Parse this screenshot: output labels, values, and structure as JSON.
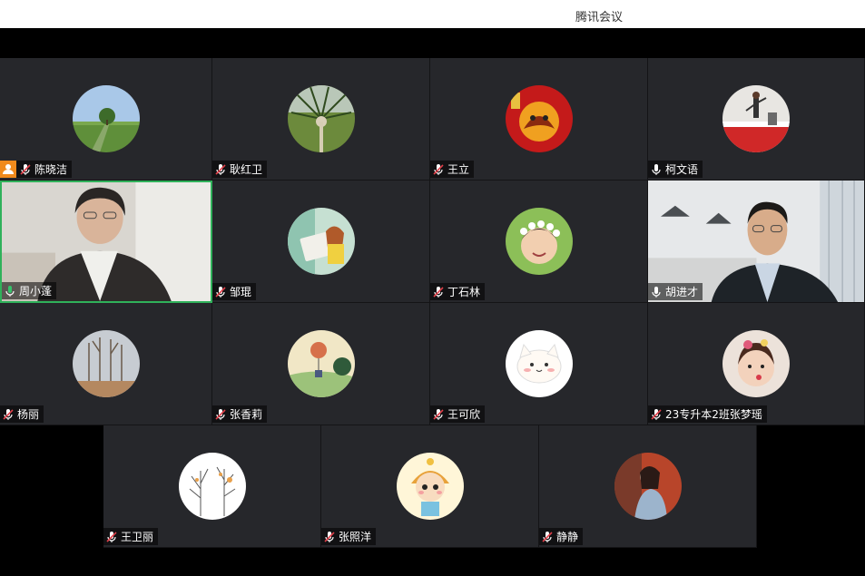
{
  "window": {
    "title": "腾讯会议"
  },
  "participants": [
    {
      "name": "陈晓洁",
      "mic": "muted",
      "host": true,
      "avatar": "landscape-tree"
    },
    {
      "name": "耿红卫",
      "mic": "muted",
      "avatar": "palm-tree"
    },
    {
      "name": "王立",
      "mic": "muted",
      "avatar": "tiger-red"
    },
    {
      "name": "柯文语",
      "mic": "on",
      "avatar": "dancer"
    },
    {
      "name": "周小蓬",
      "mic": "speaking",
      "video": true,
      "avatar": "woman-video"
    },
    {
      "name": "邹琨",
      "mic": "muted",
      "avatar": "illustration-girl"
    },
    {
      "name": "丁石林",
      "mic": "muted",
      "avatar": "child-flowers"
    },
    {
      "name": "胡进才",
      "mic": "on",
      "video": true,
      "avatar": "man-video"
    },
    {
      "name": "杨丽",
      "mic": "muted",
      "avatar": "bare-trees"
    },
    {
      "name": "张香莉",
      "mic": "muted",
      "avatar": "balloon-scene"
    },
    {
      "name": "王可欣",
      "mic": "muted",
      "avatar": "cartoon-cat"
    },
    {
      "name": "23专升本2班张梦瑶",
      "mic": "muted",
      "avatar": "baby-girl"
    },
    {
      "name": "王卫丽",
      "mic": "muted",
      "avatar": "sketch-trees"
    },
    {
      "name": "张照洋",
      "mic": "muted",
      "avatar": "cartoon-boy"
    },
    {
      "name": "静静",
      "mic": "muted",
      "avatar": "woman-photo"
    }
  ],
  "colors": {
    "active_speaker_border": "#2fb15a",
    "mic_muted": "#e0404a",
    "host_badge": "#f08a1c"
  }
}
